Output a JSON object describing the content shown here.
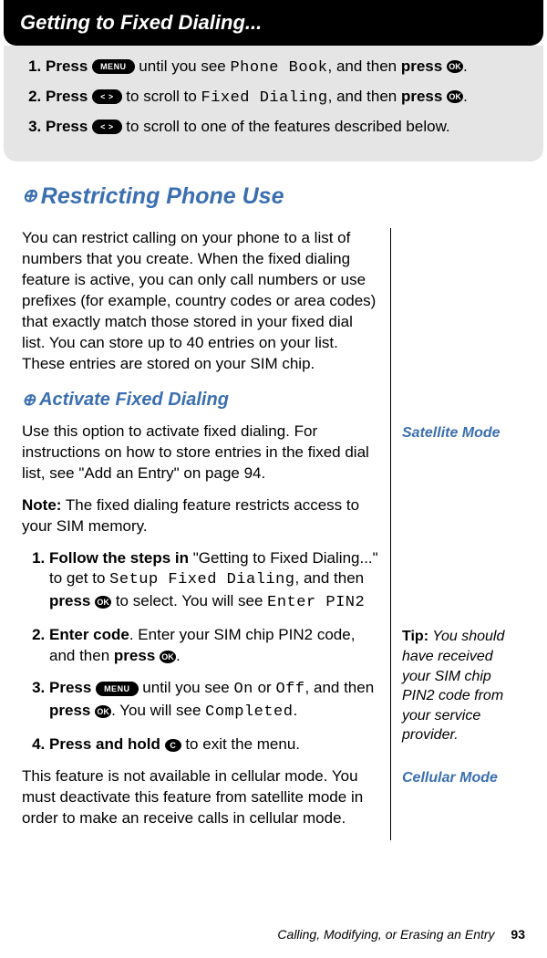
{
  "header": {
    "title": "Getting to Fixed Dialing..."
  },
  "introSteps": {
    "s1a": "Press",
    "s1_icon1": "MENU",
    "s1b": " until you see ",
    "s1_lcd": "Phone Book",
    "s1c": ", and then ",
    "s1d": "press",
    "s1_icon2": "OK",
    "s1e": ".",
    "s2a": "Press",
    "s2_icon1": "< >",
    "s2b": " to scroll to ",
    "s2_lcd": "Fixed Dialing",
    "s2c": ", and then ",
    "s2d": "press",
    "s2_icon2": "OK",
    "s2e": ".",
    "s3a": "Press",
    "s3_icon1": "< >",
    "s3b": " to scroll to one of the features described below."
  },
  "main": {
    "h_restrict": "Restricting Phone Use",
    "para1": "You can restrict calling on your phone to a list of numbers that you create. When the fixed dialing feature is active, you can only call numbers or use prefixes (for example, country codes or area codes) that exactly match those stored in your fixed dial list. You can store up to 40 entries on your list. These entries are stored on your SIM chip.",
    "h_activate": "Activate Fixed Dialing",
    "para2": "Use this option to activate fixed dialing. For instructions on how to store entries in the fixed dial list, see \"Add an Entry\" on page 94.",
    "note_label": "Note:",
    "note_text": " The fixed dialing feature restricts access to your SIM memory.",
    "act1a": "Follow the steps in",
    "act1b": " \"Getting to Fixed Dialing...\" to get to ",
    "act1_lcd1": "Setup Fixed Dialing",
    "act1c": ", and then ",
    "act1d": "press",
    "act1_icon": "OK",
    "act1e": " to select. You will see ",
    "act1_lcd2": "Enter PIN2",
    "act2a": "Enter code",
    "act2b": ". Enter your SIM chip PIN2 code, and then ",
    "act2c": "press",
    "act2_icon": "OK",
    "act2d": ".",
    "act3a": "Press",
    "act3_icon1": "MENU",
    "act3b": " until you see ",
    "act3_lcd1": "On",
    "act3c": " or ",
    "act3_lcd2": "Off",
    "act3d": ", and then ",
    "act3e": "press",
    "act3_icon2": "OK",
    "act3f": ". You will see ",
    "act3_lcd3": "Completed",
    "act3g": ".",
    "act4a": "Press and hold",
    "act4_icon": "C",
    "act4b": " to exit the menu.",
    "para3": "This feature is not available in cellular mode. You must deactivate this feature from satellite mode in order to make an receive calls in cellular mode."
  },
  "side": {
    "satellite": "Satellite Mode",
    "tip_label": "Tip:",
    "tip_text": " You should have received your SIM chip PIN2 code from your service provider.",
    "cellular": "Cellular Mode"
  },
  "footer": {
    "section": "Calling, Modifying, or Erasing an Entry",
    "page": "93"
  }
}
